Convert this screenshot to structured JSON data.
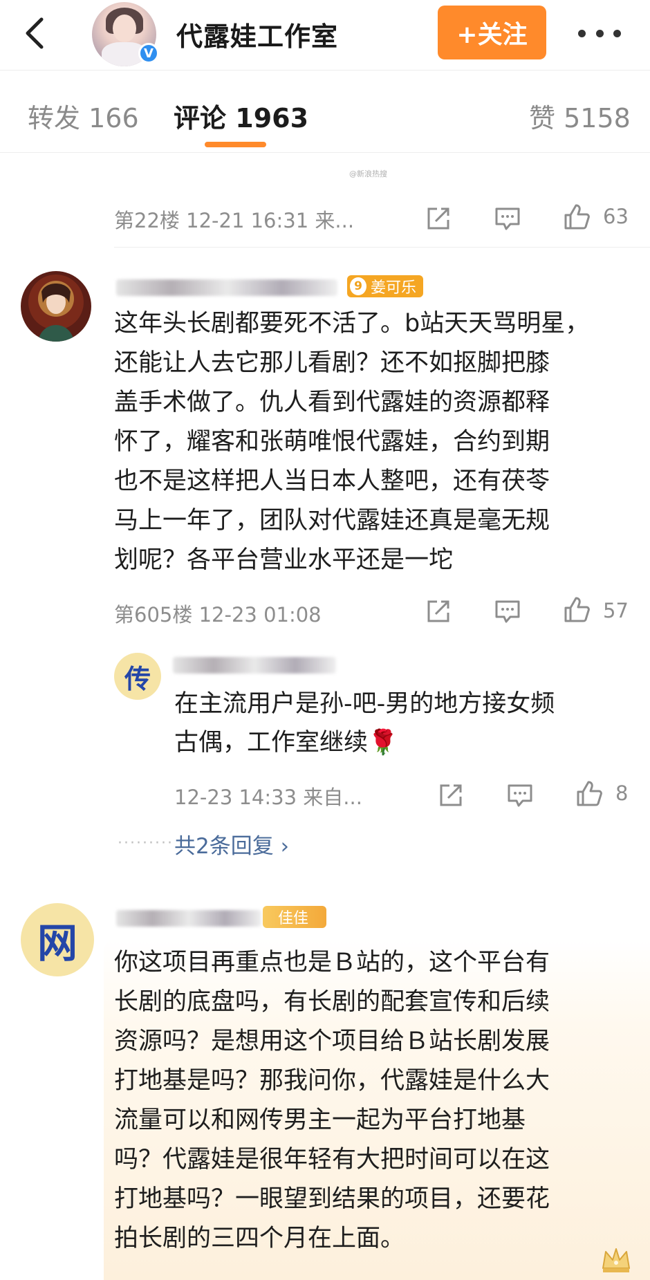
{
  "header": {
    "back_label": "<",
    "title": "代露娃工作室",
    "follow_label": "+关注",
    "verified_mark": "V"
  },
  "tabs": [
    {
      "label": "转发",
      "count": "166"
    },
    {
      "label": "评论",
      "count": "1963"
    },
    {
      "label": "赞",
      "count": "5158"
    }
  ],
  "watermark": "@新浪热搜",
  "comments": [
    {
      "floor": "第22楼",
      "time": "12-21 16:31",
      "source": "来...",
      "likes": "63"
    },
    {
      "badge_level": "9",
      "badge_text": "姜可乐",
      "text": "这年头长剧都要死不活了。b站天天骂明星，还能让人去它那儿看剧？还不如抠脚把膝盖手术做了。仇人看到代露娃的资源都释怀了，耀客和张萌唯恨代露娃，合约到期也不是这样把人当日本人整吧，还有茯苓马上一年了，团队对代露娃还真是毫无规划呢？各平台营业水平还是一坨",
      "lines": [
        "这年头长剧都要死不活了。b站天天骂明星，",
        "还能让人去它那儿看剧？还不如抠脚把膝",
        "盖手术做了。仇人看到代露娃的资源都释",
        "怀了，耀客和张萌唯恨代露娃，合约到期",
        "也不是这样把人当日本人整吧，还有茯苓",
        "马上一年了，团队对代露娃还真是毫无规",
        "划呢？各平台营业水平还是一坨"
      ],
      "floor": "第605楼",
      "time": "12-23 01:08",
      "likes": "57",
      "reply": {
        "avatar_char": "传",
        "lines": [
          "在主流用户是孙-吧-男的地方接女频",
          "古偶，工作室继续🌹"
        ],
        "time": "12-23 14:33",
        "source": "来自...",
        "likes": "8"
      },
      "more_replies": "共2条回复 ›"
    },
    {
      "avatar_char": "网",
      "badge_text": "佳佳",
      "lines": [
        "你这项目再重点也是Ｂ站的，这个平台有",
        "长剧的底盘吗，有长剧的配套宣传和后续",
        "资源吗？是想用这个项目给Ｂ站长剧发展",
        "打地基是吗？那我问你，代露娃是什么大",
        "流量可以和网传男主一起为平台打地基",
        "吗？代露娃是很年轻有大把时间可以在这",
        "打地基吗？一眼望到结果的项目，还要花",
        "拍长剧的三四个月在上面。"
      ]
    }
  ],
  "colors": {
    "accent_orange": "#ff8a2b",
    "link_blue": "#4a6b9a",
    "meta_gray": "#8d8d8d"
  }
}
